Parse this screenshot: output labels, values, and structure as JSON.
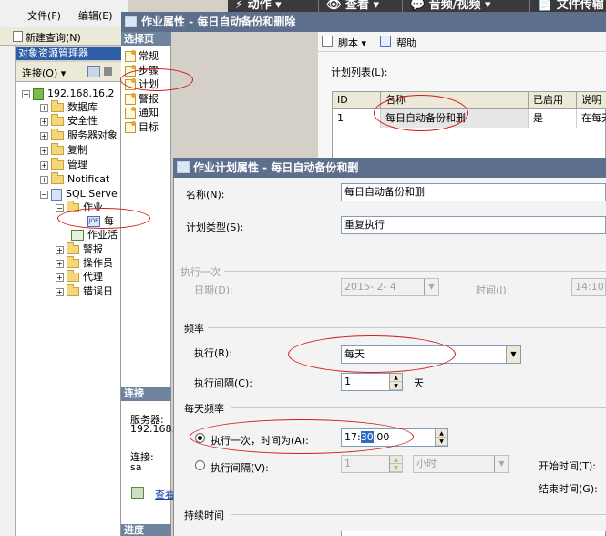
{
  "topbar": {
    "items": [
      "⚡ 动作 ▾",
      "👁 查看 ▾",
      "💬 音频/视频 ▾",
      "📄 文件传输"
    ]
  },
  "ssms": {
    "menu": {
      "file": "文件(F)",
      "edit": "编辑(E)"
    },
    "toolbar": {
      "new_query": "新建查询(N)"
    },
    "object_explorer": {
      "title": "对象资源管理器",
      "connect": "连接(O) ▾",
      "tree": {
        "server": "192.168.16.2",
        "databases": "数据库",
        "security": "安全性",
        "server_objects": "服务器对象",
        "replication": "复制",
        "management": "管理",
        "notification": "Notificat",
        "sql_agent": "SQL Serve",
        "jobs": "作业",
        "job_item": "每",
        "job_activity": "作业活",
        "alerts": "警报",
        "operators": "操作员",
        "proxies": "代理",
        "error_logs": "错误日"
      }
    }
  },
  "job_dialog": {
    "title": "作业属性 - 每日自动备份和删除",
    "select_page": "选择页",
    "pages": [
      "常规",
      "步骤",
      "计划",
      "警报",
      "通知",
      "目标"
    ],
    "connection_header": "连接",
    "server_label": "服务器:",
    "server_value": "192.168.",
    "connection_label": "连接:",
    "connection_value": "sa",
    "view_link": "查看",
    "progress_header": "进度",
    "toolbar": {
      "script": "脚本 ▾",
      "help": "帮助"
    },
    "schedule_list_label": "计划列表(L):",
    "table": {
      "headers": [
        "ID",
        "名称",
        "已启用",
        "说明"
      ],
      "rows": [
        [
          "1",
          "每日自动备份和删",
          "是",
          "在每天"
        ]
      ]
    }
  },
  "schedule_dialog": {
    "title": "作业计划属性 - 每日自动备份和删",
    "name_label": "名称(N):",
    "name_value": "每日自动备份和删",
    "schedule_type_label": "计划类型(S):",
    "schedule_type_value": "重复执行",
    "one_time_group": "执行一次",
    "date_label": "日期(D):",
    "date_value": "2015- 2- 4",
    "time_label": "时间(I):",
    "time_value": "14:10:",
    "frequency_group": "频率",
    "occurs_label": "执行(R):",
    "occurs_value": "每天",
    "recurs_label": "执行间隔(C):",
    "recurs_value": "1",
    "recurs_unit": "天",
    "daily_group": "每天频率",
    "once_at_label": "执行一次，时间为(A):",
    "once_at_value_pre": "17:",
    "once_at_value_sel": "30",
    "once_at_value_post": ":00",
    "every_label": "执行间隔(V):",
    "every_value": "1",
    "every_unit": "小时",
    "start_time_label": "开始时间(T):",
    "end_time_label": "结束时间(G):",
    "duration_group": "持续时间"
  }
}
